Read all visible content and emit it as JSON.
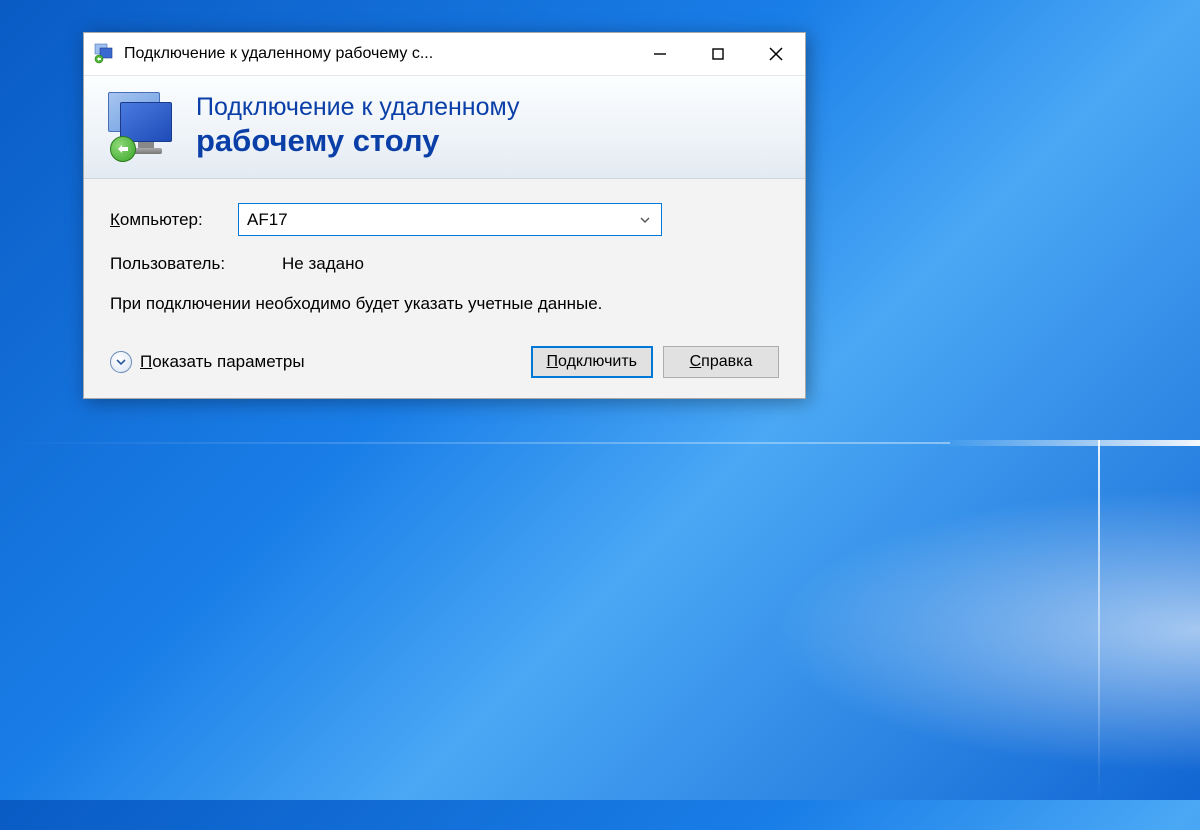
{
  "titlebar": {
    "title": "Подключение к удаленному рабочему с..."
  },
  "header": {
    "line1": "Подключение к удаленному",
    "line2": "рабочему столу"
  },
  "form": {
    "computer_label_first": "К",
    "computer_label_rest": "омпьютер:",
    "computer_value": "AF17",
    "user_label": "Пользователь:",
    "user_value": "Не задано",
    "info": "При подключении необходимо будет указать учетные данные."
  },
  "footer": {
    "show_params_first": "П",
    "show_params_rest": "оказать параметры",
    "connect_first": "П",
    "connect_rest": "одключить",
    "help_first": "С",
    "help_rest": "правка"
  }
}
